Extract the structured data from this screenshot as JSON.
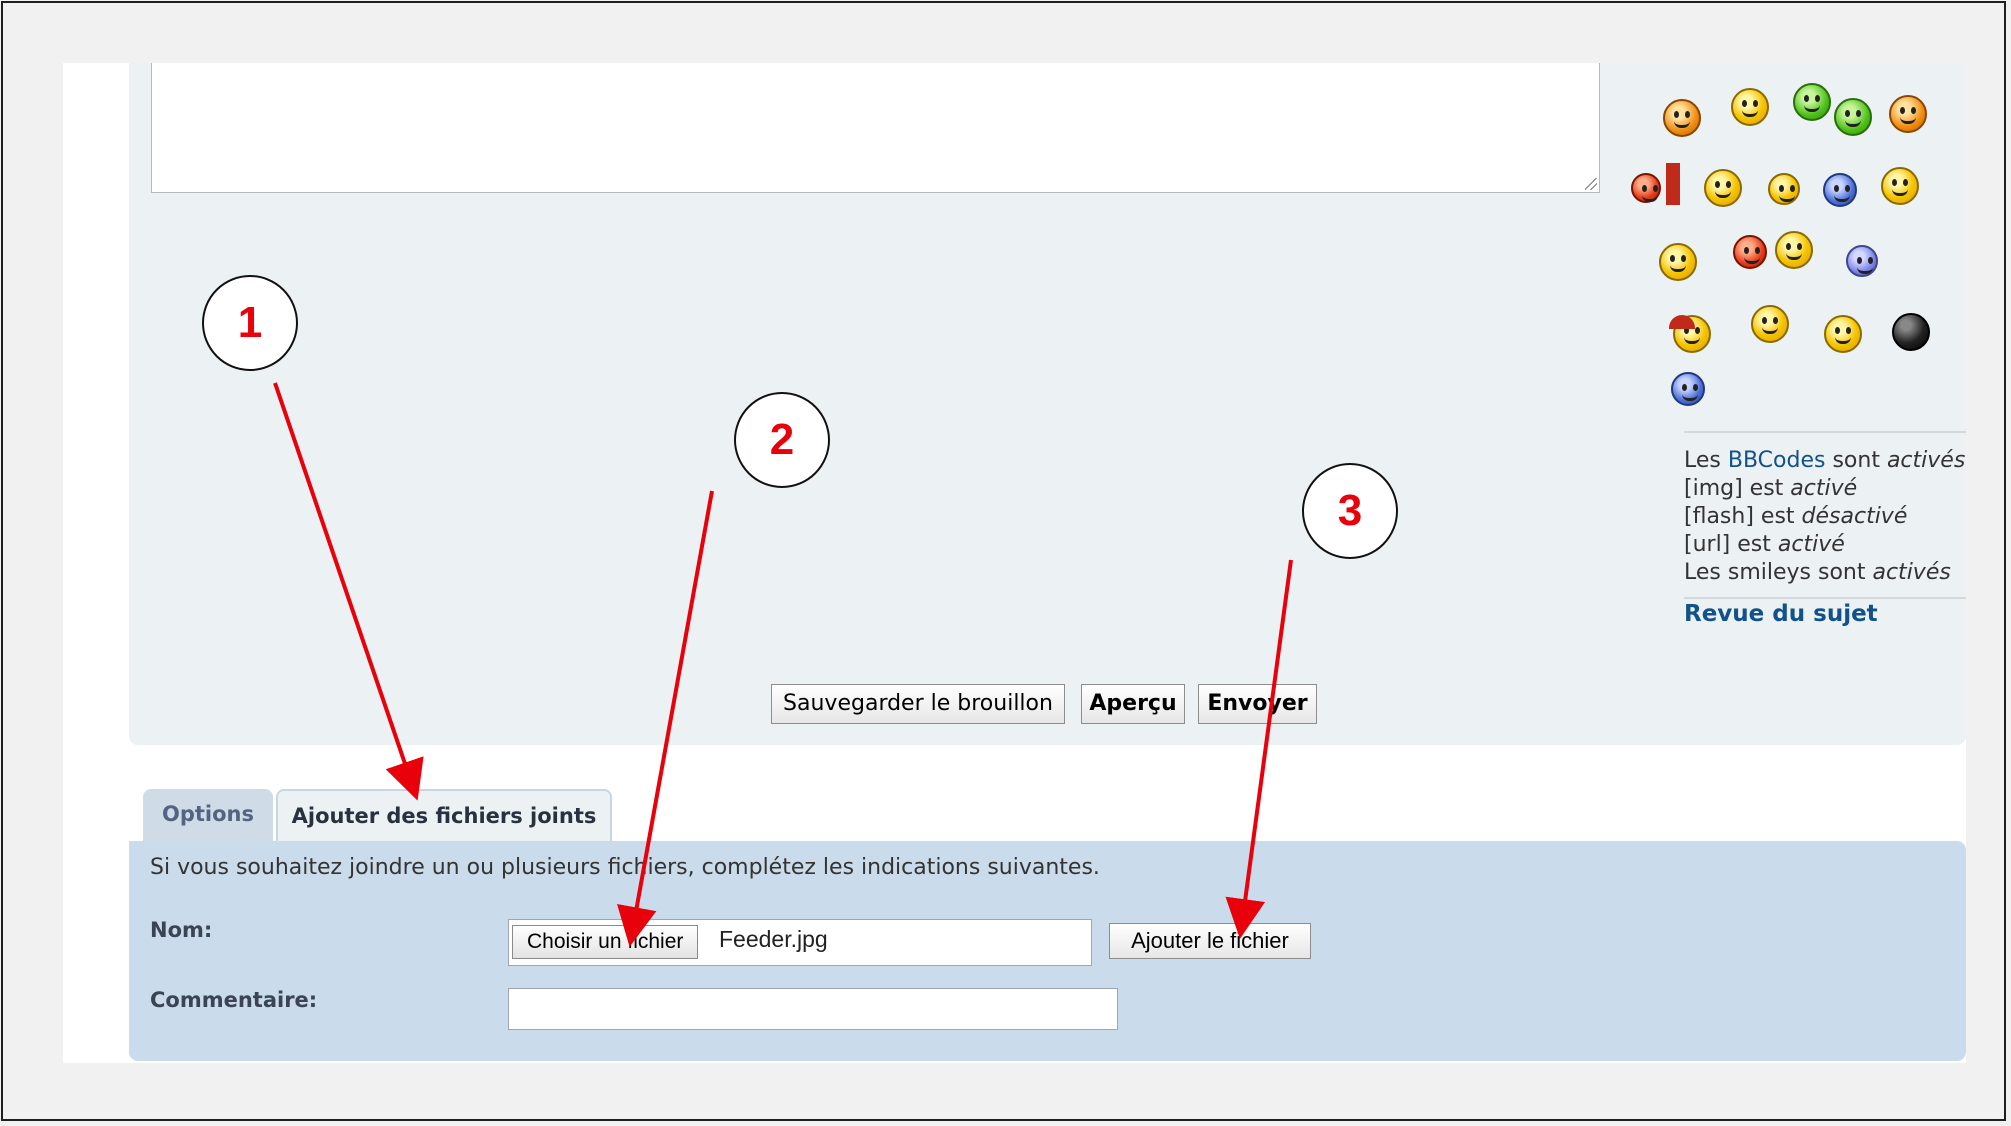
{
  "bbcode_status": {
    "line1_prefix": "Les ",
    "line1_link": "BBCodes",
    "line1_mid": " sont ",
    "line1_state": "activés",
    "line2_prefix": "[img] est ",
    "line2_state": "activé",
    "line3_prefix": "[flash] est ",
    "line3_state": "désactivé",
    "line4_prefix": "[url] est ",
    "line4_state": "activé",
    "line5_prefix": "Les smileys sont ",
    "line5_state": "activés"
  },
  "topic_review_link": "Revue du sujet",
  "submit_buttons": {
    "save_draft": "Sauvegarder le brouillon",
    "preview": "Aperçu",
    "submit": "Envoyer"
  },
  "tabs": [
    {
      "label": "Options"
    },
    {
      "label": "Ajouter des fichiers joints"
    }
  ],
  "attachments": {
    "instructions": "Si vous souhaitez joindre un ou plusieurs fichiers, complétez les indications suivantes.",
    "name_label": "Nom:",
    "choose_file_button": "Choisir un fichier",
    "selected_file": "Feeder.jpg",
    "add_file_button": "Ajouter le fichier",
    "comment_label": "Commentaire:",
    "comment_value": ""
  },
  "callouts": [
    {
      "number": "1"
    },
    {
      "number": "2"
    },
    {
      "number": "3"
    }
  ],
  "colors": {
    "annotation_red": "#e8000b",
    "link_blue": "#105289",
    "attach_panel": "#cadceb"
  }
}
